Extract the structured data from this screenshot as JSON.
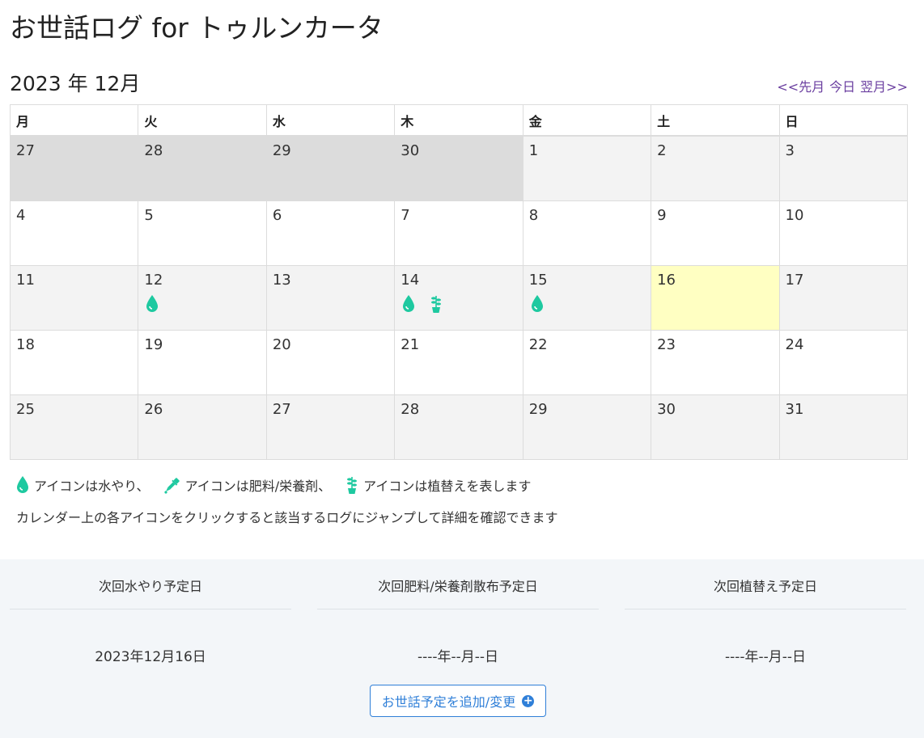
{
  "app_title": "お世話ログ for トゥルンカータ",
  "calendar": {
    "month_label": "2023 年 12月",
    "nav": {
      "prev": "<<先月",
      "today": "今日",
      "next": "翌月>>"
    },
    "weekdays": [
      "月",
      "火",
      "水",
      "木",
      "金",
      "土",
      "日"
    ],
    "weeks": [
      [
        {
          "day": "27",
          "style": "prev",
          "icons": []
        },
        {
          "day": "28",
          "style": "prev",
          "icons": []
        },
        {
          "day": "29",
          "style": "prev",
          "icons": []
        },
        {
          "day": "30",
          "style": "prev",
          "icons": []
        },
        {
          "day": "1",
          "style": "alt",
          "icons": []
        },
        {
          "day": "2",
          "style": "alt",
          "icons": []
        },
        {
          "day": "3",
          "style": "alt",
          "icons": []
        }
      ],
      [
        {
          "day": "4",
          "style": "plain",
          "icons": []
        },
        {
          "day": "5",
          "style": "plain",
          "icons": []
        },
        {
          "day": "6",
          "style": "plain",
          "icons": []
        },
        {
          "day": "7",
          "style": "plain",
          "icons": []
        },
        {
          "day": "8",
          "style": "plain",
          "icons": []
        },
        {
          "day": "9",
          "style": "plain",
          "icons": []
        },
        {
          "day": "10",
          "style": "plain",
          "icons": []
        }
      ],
      [
        {
          "day": "11",
          "style": "alt",
          "icons": []
        },
        {
          "day": "12",
          "style": "alt",
          "icons": [
            "water"
          ]
        },
        {
          "day": "13",
          "style": "alt",
          "icons": []
        },
        {
          "day": "14",
          "style": "alt",
          "icons": [
            "water",
            "repot"
          ]
        },
        {
          "day": "15",
          "style": "alt",
          "icons": [
            "water"
          ]
        },
        {
          "day": "16",
          "style": "today",
          "icons": []
        },
        {
          "day": "17",
          "style": "alt",
          "icons": []
        }
      ],
      [
        {
          "day": "18",
          "style": "plain",
          "icons": []
        },
        {
          "day": "19",
          "style": "plain",
          "icons": []
        },
        {
          "day": "20",
          "style": "plain",
          "icons": []
        },
        {
          "day": "21",
          "style": "plain",
          "icons": []
        },
        {
          "day": "22",
          "style": "plain",
          "icons": []
        },
        {
          "day": "23",
          "style": "plain",
          "icons": []
        },
        {
          "day": "24",
          "style": "plain",
          "icons": []
        }
      ],
      [
        {
          "day": "25",
          "style": "alt",
          "icons": []
        },
        {
          "day": "26",
          "style": "alt",
          "icons": []
        },
        {
          "day": "27",
          "style": "alt",
          "icons": []
        },
        {
          "day": "28",
          "style": "alt",
          "icons": []
        },
        {
          "day": "29",
          "style": "alt",
          "icons": []
        },
        {
          "day": "30",
          "style": "alt",
          "icons": []
        },
        {
          "day": "31",
          "style": "alt",
          "icons": []
        }
      ]
    ]
  },
  "legend": {
    "water_text": "アイコンは水やり、",
    "fertilizer_text": "アイコンは肥料/栄養剤、",
    "repot_text": "アイコンは植替えを表します",
    "note": "カレンダー上の各アイコンをクリックすると該当するログにジャンプして詳細を確認できます"
  },
  "schedule": {
    "water": {
      "label": "次回水やり予定日",
      "value": "2023年12月16日"
    },
    "fertilizer": {
      "label": "次回肥料/栄養剤散布予定日",
      "value": "----年--月--日"
    },
    "repot": {
      "label": "次回植替え予定日",
      "value": "----年--月--日"
    },
    "button_label": "お世話予定を追加/変更"
  },
  "colors": {
    "accent": "#1ec9a0",
    "link": "#6b3fa0",
    "button": "#2f7fd8",
    "today": "#ffffc2"
  },
  "icon_names": {
    "water": "water-drop-icon",
    "fertilizer": "fertilizer-dropper-icon",
    "repot": "repot-plant-icon",
    "add": "plus-circle-icon"
  }
}
